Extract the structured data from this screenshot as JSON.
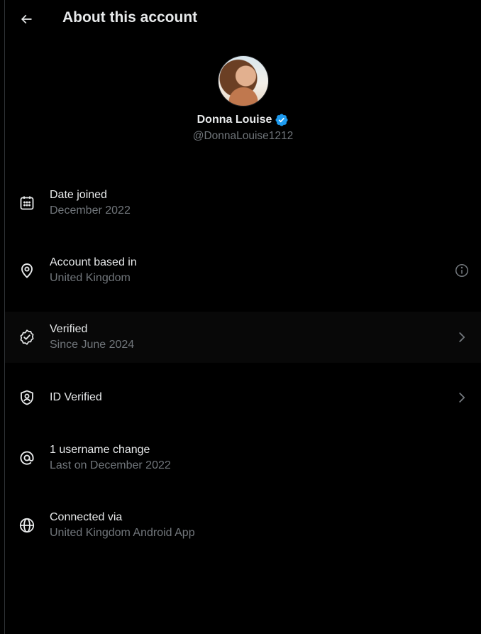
{
  "header": {
    "title": "About this account",
    "back_icon": "arrow-left-icon"
  },
  "profile": {
    "display_name": "Donna Louise",
    "handle": "@DonnaLouise1212",
    "verified_badge": "verified-badge-icon",
    "badge_color": "#1d9bf0"
  },
  "items": [
    {
      "icon": "calendar-icon",
      "label": "Date joined",
      "value": "December 2022"
    },
    {
      "icon": "location-pin-icon",
      "label": "Account based in",
      "value": "United Kingdom",
      "trailing": "info-icon"
    },
    {
      "icon": "verified-check-icon",
      "label": "Verified",
      "value": "Since June 2024",
      "trailing": "chevron-right-icon"
    },
    {
      "icon": "id-shield-icon",
      "label": "ID Verified",
      "trailing": "chevron-right-icon"
    },
    {
      "icon": "at-sign-icon",
      "label": "1 username change",
      "value": "Last on December 2022"
    },
    {
      "icon": "globe-icon",
      "label": "Connected via",
      "value": "United Kingdom Android App"
    }
  ],
  "colors": {
    "background": "#000000",
    "primary_text": "#e7e9ea",
    "secondary_text": "#71767b",
    "accent": "#1d9bf0"
  }
}
